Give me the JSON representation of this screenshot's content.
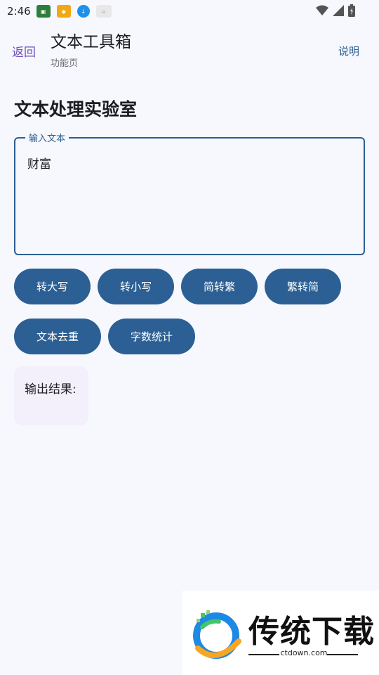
{
  "status_bar": {
    "time": "2:46"
  },
  "app_bar": {
    "back_label": "返回",
    "title": "文本工具箱",
    "subtitle": "功能页",
    "help_label": "说明"
  },
  "section": {
    "title": "文本处理实验室"
  },
  "input": {
    "label": "输入文本",
    "value": "财富"
  },
  "buttons": {
    "row1": [
      "转大写",
      "转小写",
      "简转繁",
      "繁转简"
    ],
    "row2": [
      "文本去重",
      "字数统计"
    ]
  },
  "output": {
    "label": "输出结果:"
  },
  "watermark": {
    "brand": "传统下载",
    "domain": "ctdown.com"
  },
  "colors": {
    "primary": "#2c5f93",
    "back_link": "#6f4fb8",
    "background": "#f6f8fe",
    "output_card": "#f3effb"
  }
}
